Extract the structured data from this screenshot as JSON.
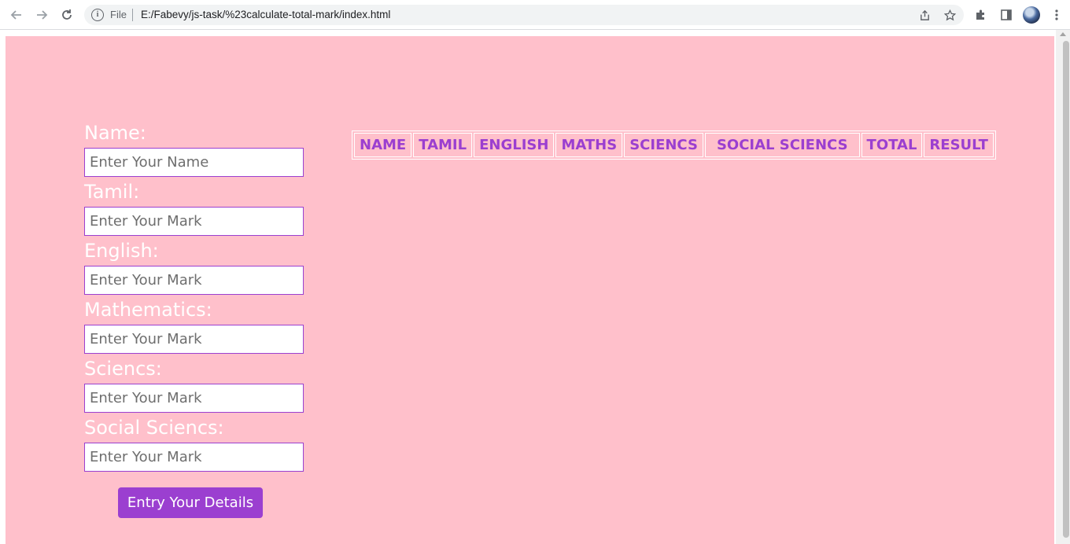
{
  "browser": {
    "scheme_label": "File",
    "url": "E:/Fabevy/js-task/%23calculate-total-mark/index.html"
  },
  "form": {
    "fields": [
      {
        "label": "Name:",
        "placeholder": "Enter Your Name"
      },
      {
        "label": "Tamil:",
        "placeholder": "Enter Your Mark"
      },
      {
        "label": "English:",
        "placeholder": "Enter Your Mark"
      },
      {
        "label": "Mathematics:",
        "placeholder": "Enter Your Mark"
      },
      {
        "label": "Sciencs:",
        "placeholder": "Enter Your Mark"
      },
      {
        "label": "Social Sciencs:",
        "placeholder": "Enter Your Mark"
      }
    ],
    "submit_label": "Entry Your Details"
  },
  "table": {
    "headers": [
      "NAME",
      "TAMIL",
      "ENGLISH",
      "MATHS",
      "SCIENCS",
      "SOCIAL SCIENCS",
      "TOTAL",
      "RESULT"
    ]
  },
  "colors": {
    "page_background": "#ffc0cb",
    "accent": "#9b3fd0"
  }
}
